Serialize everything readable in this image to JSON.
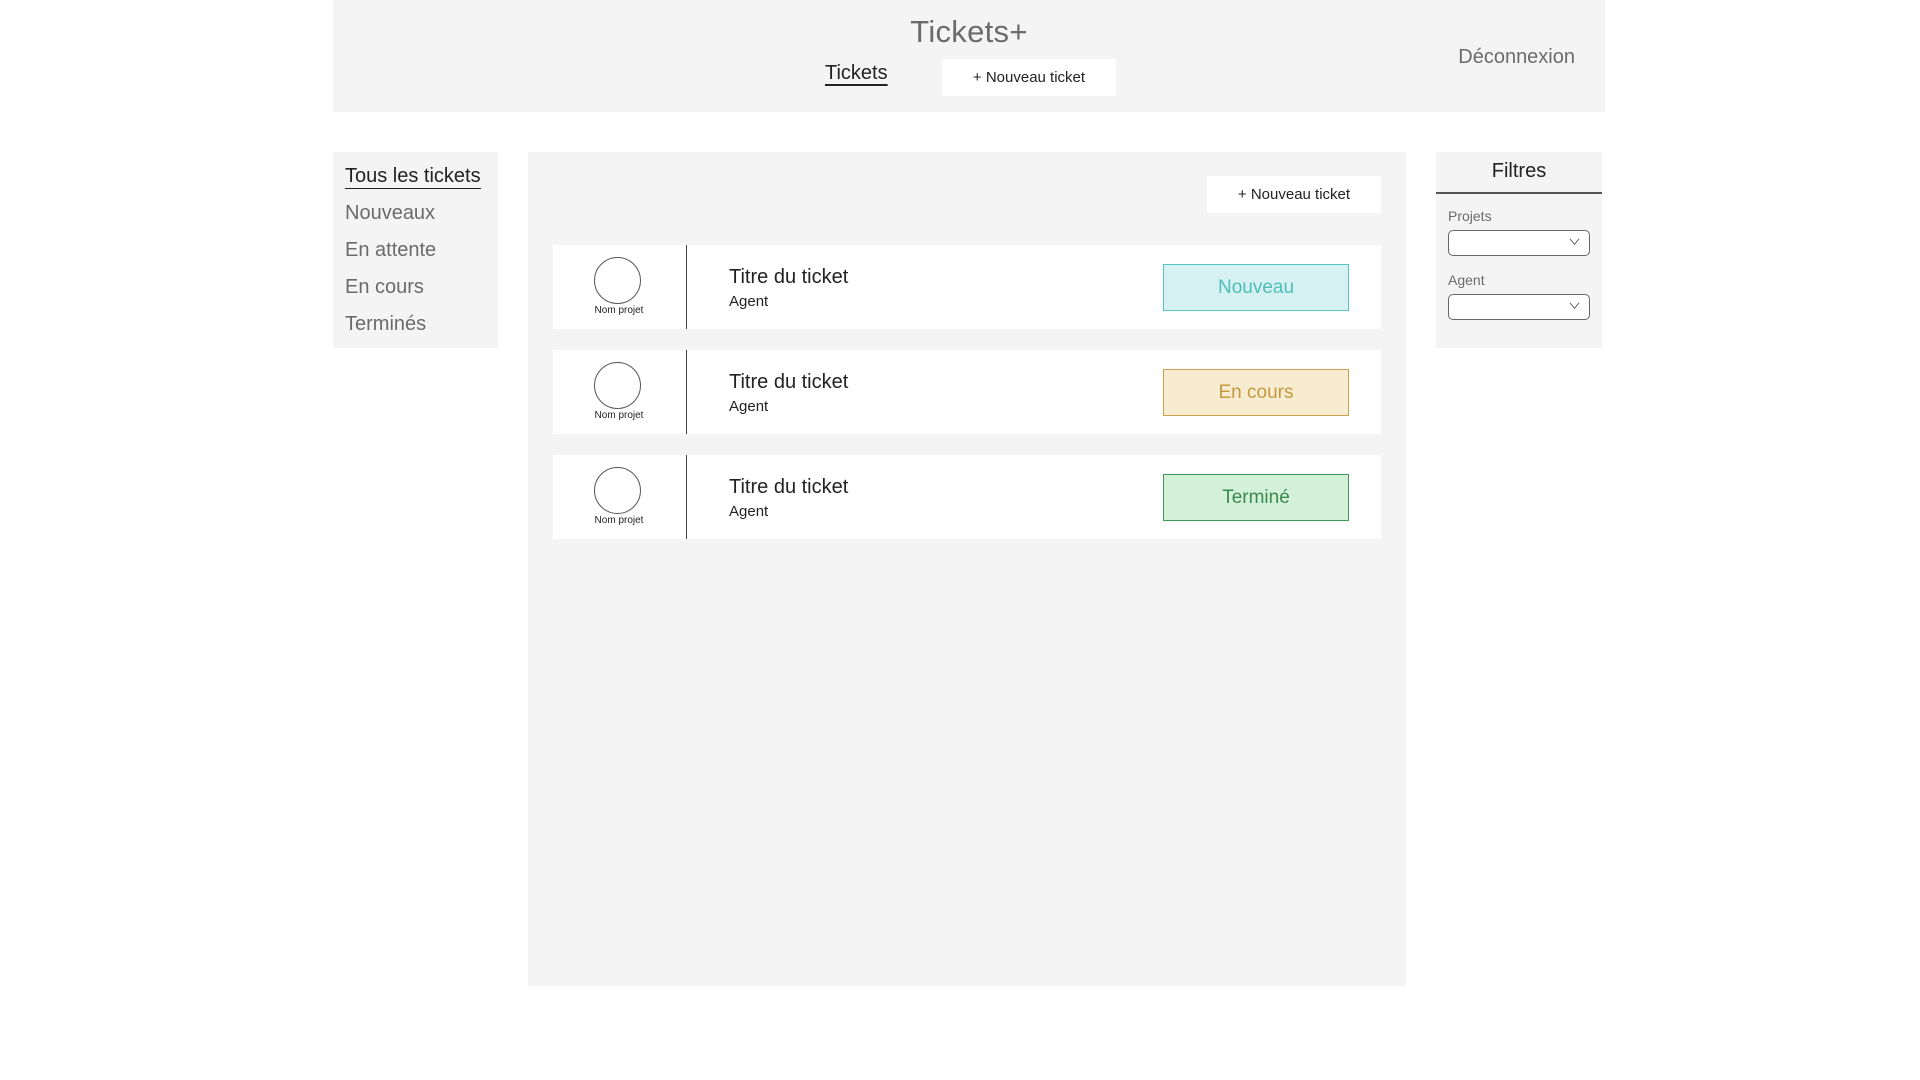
{
  "header": {
    "app_title": "Tickets+",
    "tab_tickets": "Tickets",
    "new_ticket_label": "+ Nouveau ticket",
    "logout_label": "Déconnexion"
  },
  "sidebar": {
    "items": [
      {
        "label": "Tous les tickets",
        "active": true
      },
      {
        "label": "Nouveaux",
        "active": false
      },
      {
        "label": "En attente",
        "active": false
      },
      {
        "label": "En cours",
        "active": false
      },
      {
        "label": "Terminés",
        "active": false
      }
    ]
  },
  "main": {
    "new_ticket_label": "+ Nouveau ticket",
    "tickets": [
      {
        "project": "Nom projet",
        "title": "Titre du ticket",
        "agent": "Agent",
        "status": "Nouveau",
        "status_color": "#4fbdb8"
      },
      {
        "project": "Nom projet",
        "title": "Titre du ticket",
        "agent": "Agent",
        "status": "En cours",
        "status_color": "#c4993e"
      },
      {
        "project": "Nom projet",
        "title": "Titre du ticket",
        "agent": "Agent",
        "status": "Terminé",
        "status_color": "#3b8a50"
      }
    ]
  },
  "filters": {
    "title": "Filtres",
    "projects_label": "Projets",
    "projects_value": "",
    "agent_label": "Agent",
    "agent_value": ""
  }
}
